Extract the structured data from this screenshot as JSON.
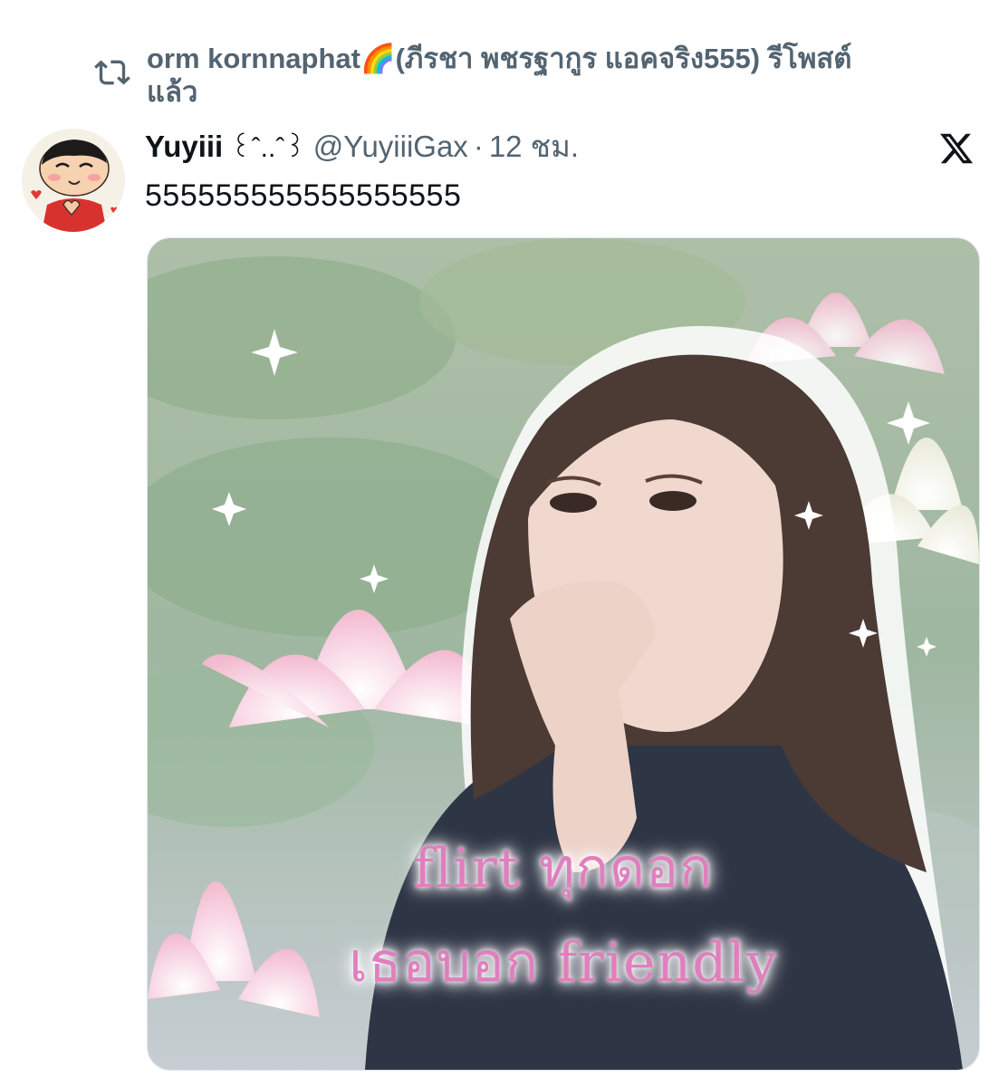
{
  "repost": {
    "icon": "repost-icon",
    "text": "orm kornnaphat🌈(ภีรชา พชรฐากูร แอคจริง555) รีโพสต์แล้ว"
  },
  "tweet": {
    "display_name": "Yuyiii",
    "name_decoration": "꒰ˆ..ˆ꒱",
    "handle": "@YuyiiiGax",
    "separator": "·",
    "time": "12 ชม.",
    "text": "555555555555555555",
    "brand_icon": "x-logo-icon",
    "avatar_icon": "cartoon-avatar"
  },
  "media": {
    "caption_line1": "flirt ทุกดอก",
    "caption_line2": "เธอบอก friendly",
    "caption_color": "#e07fbd"
  },
  "colors": {
    "text_primary": "#0f1419",
    "text_secondary": "#536471",
    "background": "#ffffff"
  }
}
